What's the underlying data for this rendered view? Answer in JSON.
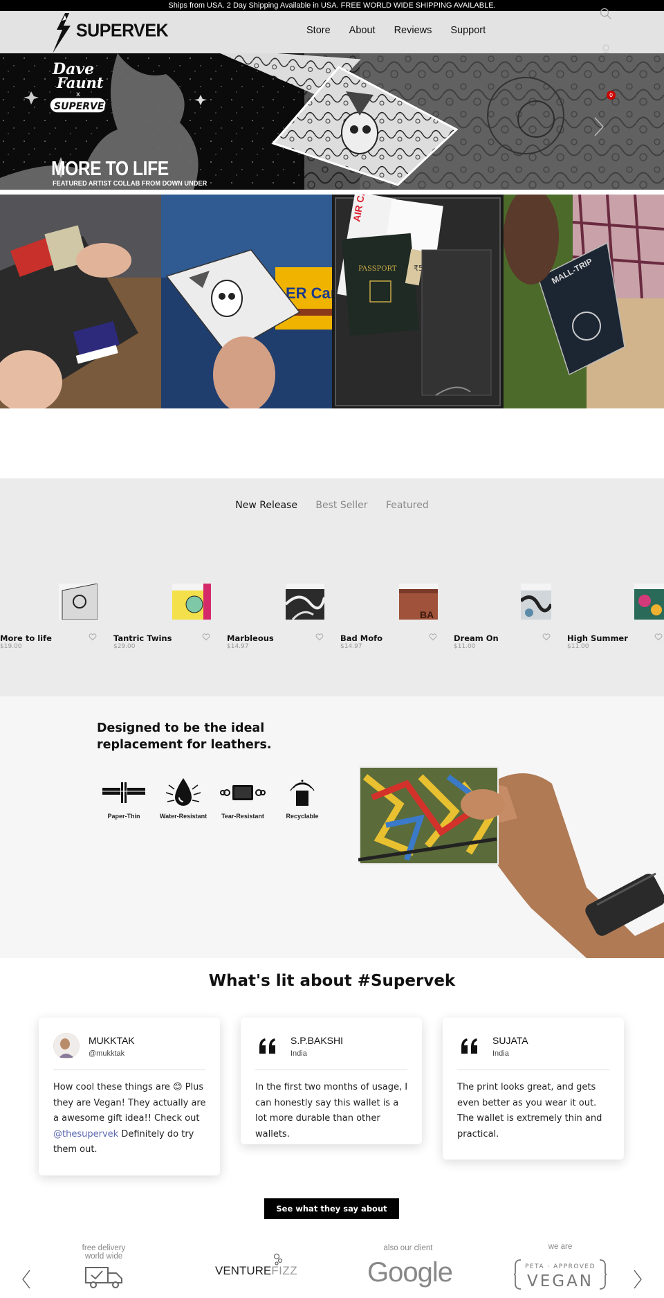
{
  "announcement": "Ships from USA. 2 Day Shipping Available in USA. FREE WORLD WIDE SHIPPING AVAILABLE.",
  "brand": {
    "name": "SUPERVEK"
  },
  "nav": [
    {
      "label": "Store"
    },
    {
      "label": "About"
    },
    {
      "label": "Reviews"
    },
    {
      "label": "Support"
    }
  ],
  "cart": {
    "count": "0"
  },
  "hero": {
    "badge_line1": "Dave",
    "badge_line2": "Faunt",
    "badge_x": "x",
    "badge_brand": "SUPERVEK",
    "title": "MORE TO LIFE",
    "subtitle": "FEATURED ARTIST COLLAB  FROM DOWN UNDER"
  },
  "strip": {
    "card_text": "ER Card",
    "air_text": "AIR CAN",
    "passport_text": "PASSPORT",
    "rupee_text": "₹500",
    "mall_text": "MALL-TRIP"
  },
  "products": {
    "tabs": [
      {
        "label": "New Release",
        "active": true
      },
      {
        "label": "Best Seller",
        "active": false
      },
      {
        "label": "Featured",
        "active": false
      }
    ],
    "items": [
      {
        "name": "More to life",
        "price": "$19.00"
      },
      {
        "name": "Tantric Twins",
        "price": "$29.00"
      },
      {
        "name": "Marbleous",
        "price": "$14.97"
      },
      {
        "name": "Bad Mofo",
        "price": "$14.97"
      },
      {
        "name": "Dream On",
        "price": "$11.00"
      },
      {
        "name": "High Summer",
        "price": "$11.00"
      }
    ]
  },
  "features": {
    "title": "Designed to be the ideal replacement for leathers.",
    "items": [
      {
        "label": "Paper-Thin",
        "icon": "paper-thin-icon"
      },
      {
        "label": "Water-Resistant",
        "icon": "water-drop-icon"
      },
      {
        "label": "Tear-Resistant",
        "icon": "tear-resistant-icon"
      },
      {
        "label": "Recyclable",
        "icon": "recyclable-icon"
      }
    ]
  },
  "testimonials": {
    "title": "What's lit about #Supervek",
    "items": [
      {
        "name": "MUKKTAK",
        "handle": "@mukktak",
        "text_before": "How cool these things are 😊 Plus they are Vegan! They actually are a awesome gift idea!! Check out ",
        "mention": "@thesupervek",
        "text_after": " Definitely do try them out."
      },
      {
        "name": "S.P.BAKSHI",
        "handle": "India",
        "text": "In the first two months of usage, I can honestly say this wallet is a lot more durable than other wallets."
      },
      {
        "name": "SUJATA",
        "handle": "India",
        "text": "The print looks great, and gets even better as you wear it out. The wallet is extremely thin and practical."
      }
    ],
    "cta": "See what they say about"
  },
  "logos": {
    "delivery_caption": "free delivery\nworld wide",
    "venture_main": "VENTURE",
    "venture_fizz": "FIZZ",
    "client_caption": "also our client",
    "google": "Google",
    "vegan_caption": "we are",
    "vegan_top": "PETA · APPROVED",
    "vegan_main": "VEGAN"
  },
  "colors": {
    "mention": "#5a67b0",
    "cart_badge": "#cc0000",
    "products_bg": "#ebebeb",
    "features_bg": "#f6f6f6"
  }
}
